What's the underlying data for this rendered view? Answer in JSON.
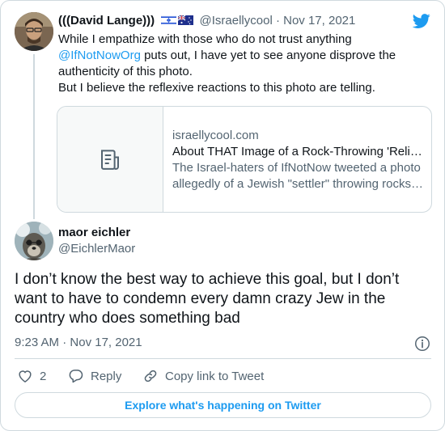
{
  "brand": {
    "icon": "twitter-bird-icon",
    "color": "#1d9bf0"
  },
  "parent_tweet": {
    "name": "(((David Lange)))",
    "flags": [
      "israel-flag-icon",
      "australia-flag-icon"
    ],
    "handle": "@Israellycool",
    "separator": "·",
    "date": "Nov 17, 2021",
    "text_line1": "While I empathize with those who do not trust anything",
    "mention": "@IfNotNowOrg",
    "text_line2_rest": " puts out, I have yet to see anyone disprove the",
    "text_line3": "authenticity of this photo.",
    "text_line4": "But I believe the reflexive reactions to this photo are telling.",
    "link_card": {
      "icon": "article-icon",
      "domain": "israellycool.com",
      "title": "About THAT Image of a Rock-Throwing 'Religious Settler'",
      "desc_line1": "The Israel-haters of IfNotNow tweeted a photo",
      "desc_line2": "allegedly of a Jewish \"settler\" throwing rocks at Palestinians"
    }
  },
  "main_tweet": {
    "name": "maor eichler",
    "handle": "@EichlerMaor",
    "text": "I don’t know the best way to achieve this goal, but I don’t want to have to condemn every damn crazy Jew in the country who does something bad",
    "time": "9:23 AM",
    "separator": "·",
    "date": "Nov 17, 2021",
    "info_icon": "info-icon"
  },
  "actions": {
    "like_count": "2",
    "reply_label": "Reply",
    "copy_label": "Copy link to Tweet"
  },
  "explore_label": "Explore what's happening on Twitter"
}
